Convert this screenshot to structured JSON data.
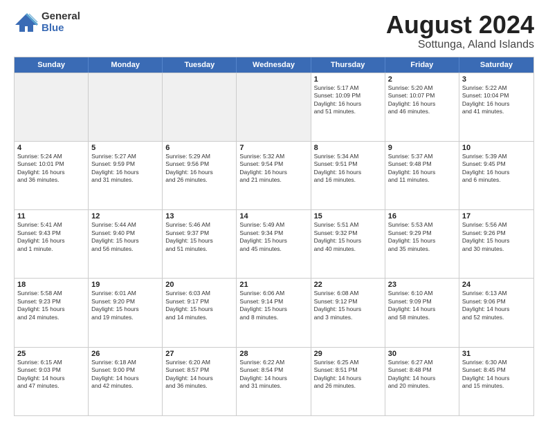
{
  "logo": {
    "general": "General",
    "blue": "Blue"
  },
  "title": "August 2024",
  "subtitle": "Sottunga, Aland Islands",
  "header_days": [
    "Sunday",
    "Monday",
    "Tuesday",
    "Wednesday",
    "Thursday",
    "Friday",
    "Saturday"
  ],
  "rows": [
    [
      {
        "day": "",
        "text": "",
        "empty": true
      },
      {
        "day": "",
        "text": "",
        "empty": true
      },
      {
        "day": "",
        "text": "",
        "empty": true
      },
      {
        "day": "",
        "text": "",
        "empty": true
      },
      {
        "day": "1",
        "text": "Sunrise: 5:17 AM\nSunset: 10:09 PM\nDaylight: 16 hours\nand 51 minutes."
      },
      {
        "day": "2",
        "text": "Sunrise: 5:20 AM\nSunset: 10:07 PM\nDaylight: 16 hours\nand 46 minutes."
      },
      {
        "day": "3",
        "text": "Sunrise: 5:22 AM\nSunset: 10:04 PM\nDaylight: 16 hours\nand 41 minutes."
      }
    ],
    [
      {
        "day": "4",
        "text": "Sunrise: 5:24 AM\nSunset: 10:01 PM\nDaylight: 16 hours\nand 36 minutes."
      },
      {
        "day": "5",
        "text": "Sunrise: 5:27 AM\nSunset: 9:59 PM\nDaylight: 16 hours\nand 31 minutes."
      },
      {
        "day": "6",
        "text": "Sunrise: 5:29 AM\nSunset: 9:56 PM\nDaylight: 16 hours\nand 26 minutes."
      },
      {
        "day": "7",
        "text": "Sunrise: 5:32 AM\nSunset: 9:54 PM\nDaylight: 16 hours\nand 21 minutes."
      },
      {
        "day": "8",
        "text": "Sunrise: 5:34 AM\nSunset: 9:51 PM\nDaylight: 16 hours\nand 16 minutes."
      },
      {
        "day": "9",
        "text": "Sunrise: 5:37 AM\nSunset: 9:48 PM\nDaylight: 16 hours\nand 11 minutes."
      },
      {
        "day": "10",
        "text": "Sunrise: 5:39 AM\nSunset: 9:45 PM\nDaylight: 16 hours\nand 6 minutes."
      }
    ],
    [
      {
        "day": "11",
        "text": "Sunrise: 5:41 AM\nSunset: 9:43 PM\nDaylight: 16 hours\nand 1 minute."
      },
      {
        "day": "12",
        "text": "Sunrise: 5:44 AM\nSunset: 9:40 PM\nDaylight: 15 hours\nand 56 minutes."
      },
      {
        "day": "13",
        "text": "Sunrise: 5:46 AM\nSunset: 9:37 PM\nDaylight: 15 hours\nand 51 minutes."
      },
      {
        "day": "14",
        "text": "Sunrise: 5:49 AM\nSunset: 9:34 PM\nDaylight: 15 hours\nand 45 minutes."
      },
      {
        "day": "15",
        "text": "Sunrise: 5:51 AM\nSunset: 9:32 PM\nDaylight: 15 hours\nand 40 minutes."
      },
      {
        "day": "16",
        "text": "Sunrise: 5:53 AM\nSunset: 9:29 PM\nDaylight: 15 hours\nand 35 minutes."
      },
      {
        "day": "17",
        "text": "Sunrise: 5:56 AM\nSunset: 9:26 PM\nDaylight: 15 hours\nand 30 minutes."
      }
    ],
    [
      {
        "day": "18",
        "text": "Sunrise: 5:58 AM\nSunset: 9:23 PM\nDaylight: 15 hours\nand 24 minutes."
      },
      {
        "day": "19",
        "text": "Sunrise: 6:01 AM\nSunset: 9:20 PM\nDaylight: 15 hours\nand 19 minutes."
      },
      {
        "day": "20",
        "text": "Sunrise: 6:03 AM\nSunset: 9:17 PM\nDaylight: 15 hours\nand 14 minutes."
      },
      {
        "day": "21",
        "text": "Sunrise: 6:06 AM\nSunset: 9:14 PM\nDaylight: 15 hours\nand 8 minutes."
      },
      {
        "day": "22",
        "text": "Sunrise: 6:08 AM\nSunset: 9:12 PM\nDaylight: 15 hours\nand 3 minutes."
      },
      {
        "day": "23",
        "text": "Sunrise: 6:10 AM\nSunset: 9:09 PM\nDaylight: 14 hours\nand 58 minutes."
      },
      {
        "day": "24",
        "text": "Sunrise: 6:13 AM\nSunset: 9:06 PM\nDaylight: 14 hours\nand 52 minutes."
      }
    ],
    [
      {
        "day": "25",
        "text": "Sunrise: 6:15 AM\nSunset: 9:03 PM\nDaylight: 14 hours\nand 47 minutes."
      },
      {
        "day": "26",
        "text": "Sunrise: 6:18 AM\nSunset: 9:00 PM\nDaylight: 14 hours\nand 42 minutes."
      },
      {
        "day": "27",
        "text": "Sunrise: 6:20 AM\nSunset: 8:57 PM\nDaylight: 14 hours\nand 36 minutes."
      },
      {
        "day": "28",
        "text": "Sunrise: 6:22 AM\nSunset: 8:54 PM\nDaylight: 14 hours\nand 31 minutes."
      },
      {
        "day": "29",
        "text": "Sunrise: 6:25 AM\nSunset: 8:51 PM\nDaylight: 14 hours\nand 26 minutes."
      },
      {
        "day": "30",
        "text": "Sunrise: 6:27 AM\nSunset: 8:48 PM\nDaylight: 14 hours\nand 20 minutes."
      },
      {
        "day": "31",
        "text": "Sunrise: 6:30 AM\nSunset: 8:45 PM\nDaylight: 14 hours\nand 15 minutes."
      }
    ]
  ]
}
